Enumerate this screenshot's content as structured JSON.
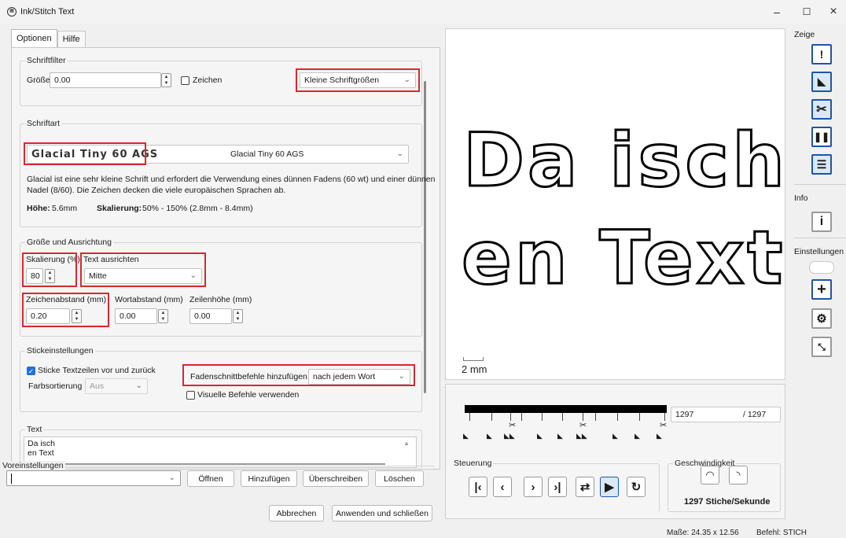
{
  "window": {
    "title": "Ink/Stitch Text",
    "minimize": "–",
    "maximize": "☐",
    "close": "×"
  },
  "tabs": [
    "Optionen",
    "Hilfe"
  ],
  "font_filter": {
    "title": "Schriftfilter",
    "size_label": "Größe",
    "size_value": "0.00",
    "glyphs_label": "Zeichen",
    "size_category": "Kleine Schriftgrößen"
  },
  "font": {
    "title": "Schriftart",
    "preview": "Glacial Tiny 60 AGS",
    "name": "Glacial Tiny 60 AGS",
    "description_line1": "Glacial ist eine sehr kleine Schrift und erfordert die Verwendung eines dünnen Fadens (60 wt) und einer dünnen",
    "description_line2": "Nadel (8/60). Die Zeichen decken die viele europäischen Sprachen ab.",
    "height_label": "Höhe:",
    "height_value": "5.6mm",
    "scale_label": "Skalierung:",
    "scale_value": "50% - 150% (2.8mm - 8.4mm)"
  },
  "size_alignment": {
    "title": "Größe und Ausrichtung",
    "scaling_label": "Skalierung (%)",
    "scaling_value": "80",
    "align_label": "Text ausrichten",
    "align_value": "Mitte",
    "letter_spacing_label": "Zeichenabstand (mm)",
    "letter_spacing_value": "0.20",
    "word_spacing_label": "Wortabstand (mm)",
    "word_spacing_value": "0.00",
    "line_height_label": "Zeilenhöhe (mm)",
    "line_height_value": "0.00"
  },
  "stitch_settings": {
    "title": "Stickeinstellungen",
    "back_forth_label": "Sticke Textzeilen vor und zurück",
    "color_sort_label": "Farbsortierung",
    "color_sort_value": "Aus",
    "trim_label": "Fadenschnittbefehle hinzufügen",
    "trim_value": "nach jedem Wort",
    "visual_commands_label": "Visuelle Befehle verwenden"
  },
  "text_section": {
    "title": "Text",
    "line1": "Da isch",
    "line2": "en Text"
  },
  "presets": {
    "title": "Voreinstellungen",
    "open": "Öffnen",
    "add": "Hinzufügen",
    "overwrite": "Überschreiben",
    "delete": "Löschen"
  },
  "footer_buttons": {
    "cancel": "Abbrechen",
    "apply": "Anwenden und schließen"
  },
  "preview": {
    "line1": "Da isch",
    "line2": "en Text",
    "scale_label": "2 mm"
  },
  "sidebar": {
    "show_label": "Zeige",
    "info_label": "Info",
    "settings_label": "Einstellungen"
  },
  "simulator": {
    "current_stitch": "1297",
    "total_stitches": "/ 1297",
    "control_label": "Steuerung",
    "speed_label": "Geschwindigkeit",
    "speed_value": "1297 Stiche/Sekunde"
  },
  "status": {
    "dimensions": "Maße: 24.35 x 12.56",
    "command": "Befehl: STICH"
  },
  "colors": {
    "accent": "#1c56a6",
    "highlight": "#d9272e",
    "checkbox": "#1f72d9"
  }
}
